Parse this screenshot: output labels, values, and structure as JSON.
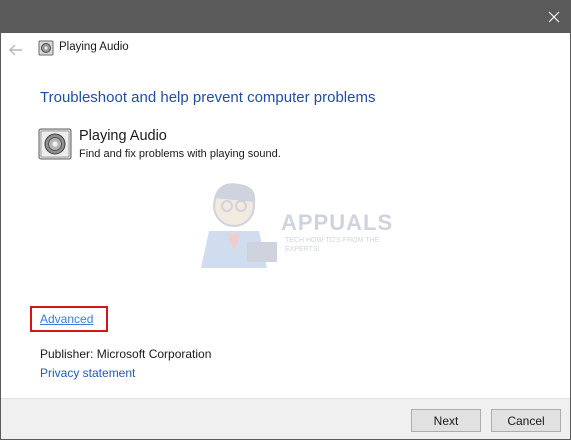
{
  "window": {
    "title": "Playing Audio"
  },
  "main": {
    "heading": "Troubleshoot and help prevent computer problems",
    "item": {
      "title": "Playing Audio",
      "description": "Find and fix problems with playing sound.",
      "icon": "speaker-icon"
    },
    "advanced_link": "Advanced",
    "publisher": "Publisher:  Microsoft Corporation",
    "privacy_link": "Privacy statement"
  },
  "watermark": {
    "brand": "APPUALS",
    "tagline": "TECH HOW-TO'S FROM THE EXPERTS!"
  },
  "footer": {
    "next_label": "Next",
    "cancel_label": "Cancel"
  },
  "colors": {
    "titlebar": "#5a5a5a",
    "heading": "#1f4e9e",
    "link": "#1f5bb8",
    "highlight_box": "#d4161c",
    "footer": "#f0f0f0"
  }
}
